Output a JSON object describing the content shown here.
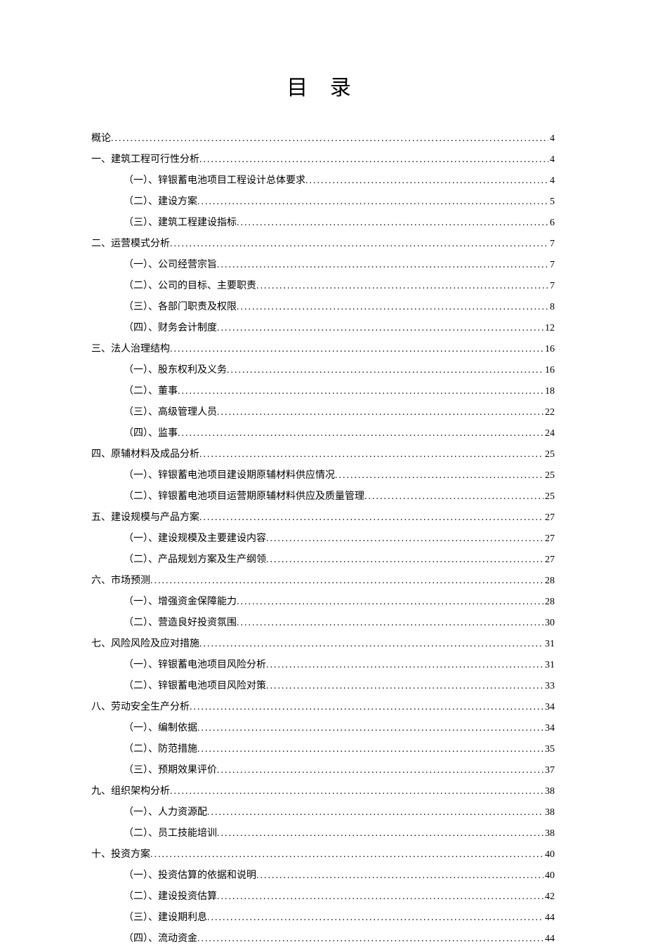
{
  "title": "目 录",
  "toc": [
    {
      "level": 1,
      "label": "概论",
      "page": "4"
    },
    {
      "level": 1,
      "label": "一、建筑工程可行性分析",
      "page": "4"
    },
    {
      "level": 2,
      "label": "（一）、锌银蓄电池项目工程设计总体要求",
      "page": "4"
    },
    {
      "level": 2,
      "label": "（二）、建设方案",
      "page": "5"
    },
    {
      "level": 2,
      "label": "（三）、建筑工程建设指标",
      "page": "6"
    },
    {
      "level": 1,
      "label": "二、运营模式分析",
      "page": "7"
    },
    {
      "level": 2,
      "label": "（一）、公司经营宗旨",
      "page": "7"
    },
    {
      "level": 2,
      "label": "（二）、公司的目标、主要职责",
      "page": "7"
    },
    {
      "level": 2,
      "label": "（三）、各部门职责及权限",
      "page": "8"
    },
    {
      "level": 2,
      "label": "（四）、财务会计制度",
      "page": "12"
    },
    {
      "level": 1,
      "label": "三、法人治理结构",
      "page": "16"
    },
    {
      "level": 2,
      "label": "（一）、股东权利及义务",
      "page": "16"
    },
    {
      "level": 2,
      "label": "（二）、董事",
      "page": "18"
    },
    {
      "level": 2,
      "label": "（三）、高级管理人员",
      "page": "22"
    },
    {
      "level": 2,
      "label": "（四）、监事",
      "page": "24"
    },
    {
      "level": 1,
      "label": "四、原辅材料及成品分析",
      "page": "25"
    },
    {
      "level": 2,
      "label": "（一）、锌银蓄电池项目建设期原辅材料供应情况",
      "page": "25"
    },
    {
      "level": 2,
      "label": "（二）、锌银蓄电池项目运营期原辅材料供应及质量管理",
      "page": "25"
    },
    {
      "level": 1,
      "label": "五、建设规模与产品方案",
      "page": "27"
    },
    {
      "level": 2,
      "label": "（一）、建设规模及主要建设内容",
      "page": "27"
    },
    {
      "level": 2,
      "label": "（二）、产品规划方案及生产纲领",
      "page": "27"
    },
    {
      "level": 1,
      "label": "六、市场预测",
      "page": "28"
    },
    {
      "level": 2,
      "label": "（一）、增强资金保障能力",
      "page": "28"
    },
    {
      "level": 2,
      "label": "（二）、营造良好投资氛围",
      "page": "30"
    },
    {
      "level": 1,
      "label": "七、风险风险及应对措施",
      "page": "31"
    },
    {
      "level": 2,
      "label": "（一）、锌银蓄电池项目风险分析",
      "page": "31"
    },
    {
      "level": 2,
      "label": "（二）、锌银蓄电池项目风险对策",
      "page": "33"
    },
    {
      "level": 1,
      "label": "八、劳动安全生产分析",
      "page": "34"
    },
    {
      "level": 2,
      "label": "（一）、编制依据",
      "page": "34"
    },
    {
      "level": 2,
      "label": "（二）、防范措施",
      "page": "35"
    },
    {
      "level": 2,
      "label": "（三）、预期效果评价",
      "page": "37"
    },
    {
      "level": 1,
      "label": "九、组织架构分析",
      "page": "38"
    },
    {
      "level": 2,
      "label": "（一）、人力资源配",
      "page": "38"
    },
    {
      "level": 2,
      "label": "（二）、员工技能培训",
      "page": "38"
    },
    {
      "level": 1,
      "label": "十、投资方案",
      "page": "40"
    },
    {
      "level": 2,
      "label": "（一）、投资估算的依据和说明",
      "page": "40"
    },
    {
      "level": 2,
      "label": "（二）、建设投资估算",
      "page": "42"
    },
    {
      "level": 2,
      "label": "（三）、建设期利息",
      "page": "44"
    },
    {
      "level": 2,
      "label": "（四）、流动资金",
      "page": "44"
    }
  ]
}
